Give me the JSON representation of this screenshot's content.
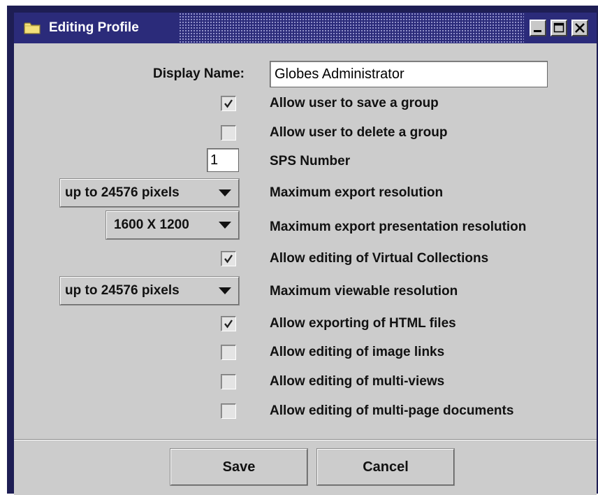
{
  "window": {
    "title": "Editing Profile",
    "titlebar_color": "#2b2b7a",
    "client_color": "#cccccc",
    "icon": "folder-icon",
    "controls": [
      "minimize-icon",
      "maximize-icon",
      "close-icon"
    ]
  },
  "form": {
    "display_name_label": "Display Name:",
    "display_name_value": "Globes Administrator",
    "save_group": {
      "label": "Allow user to save a group",
      "checked": true
    },
    "delete_group": {
      "label": "Allow user to delete a group",
      "checked": false
    },
    "sps_number": {
      "label": "SPS Number",
      "value": "1"
    },
    "max_export_resolution": {
      "label": "Maximum export resolution",
      "selected": "up to 24576 pixels"
    },
    "max_export_presentation_resolution": {
      "label": "Maximum export presentation resolution",
      "selected": "1600 X 1200"
    },
    "virtual_collections": {
      "label": "Allow editing of Virtual Collections",
      "checked": true
    },
    "max_viewable_resolution": {
      "label": "Maximum viewable resolution",
      "selected": "up to 24576 pixels"
    },
    "export_html": {
      "label": "Allow exporting of HTML files",
      "checked": true
    },
    "image_links": {
      "label": "Allow editing of image links",
      "checked": false
    },
    "multi_views": {
      "label": "Allow editing of multi-views",
      "checked": false
    },
    "multi_page": {
      "label": "Allow editing of multi-page documents",
      "checked": false
    }
  },
  "buttons": {
    "save": "Save",
    "cancel": "Cancel"
  }
}
